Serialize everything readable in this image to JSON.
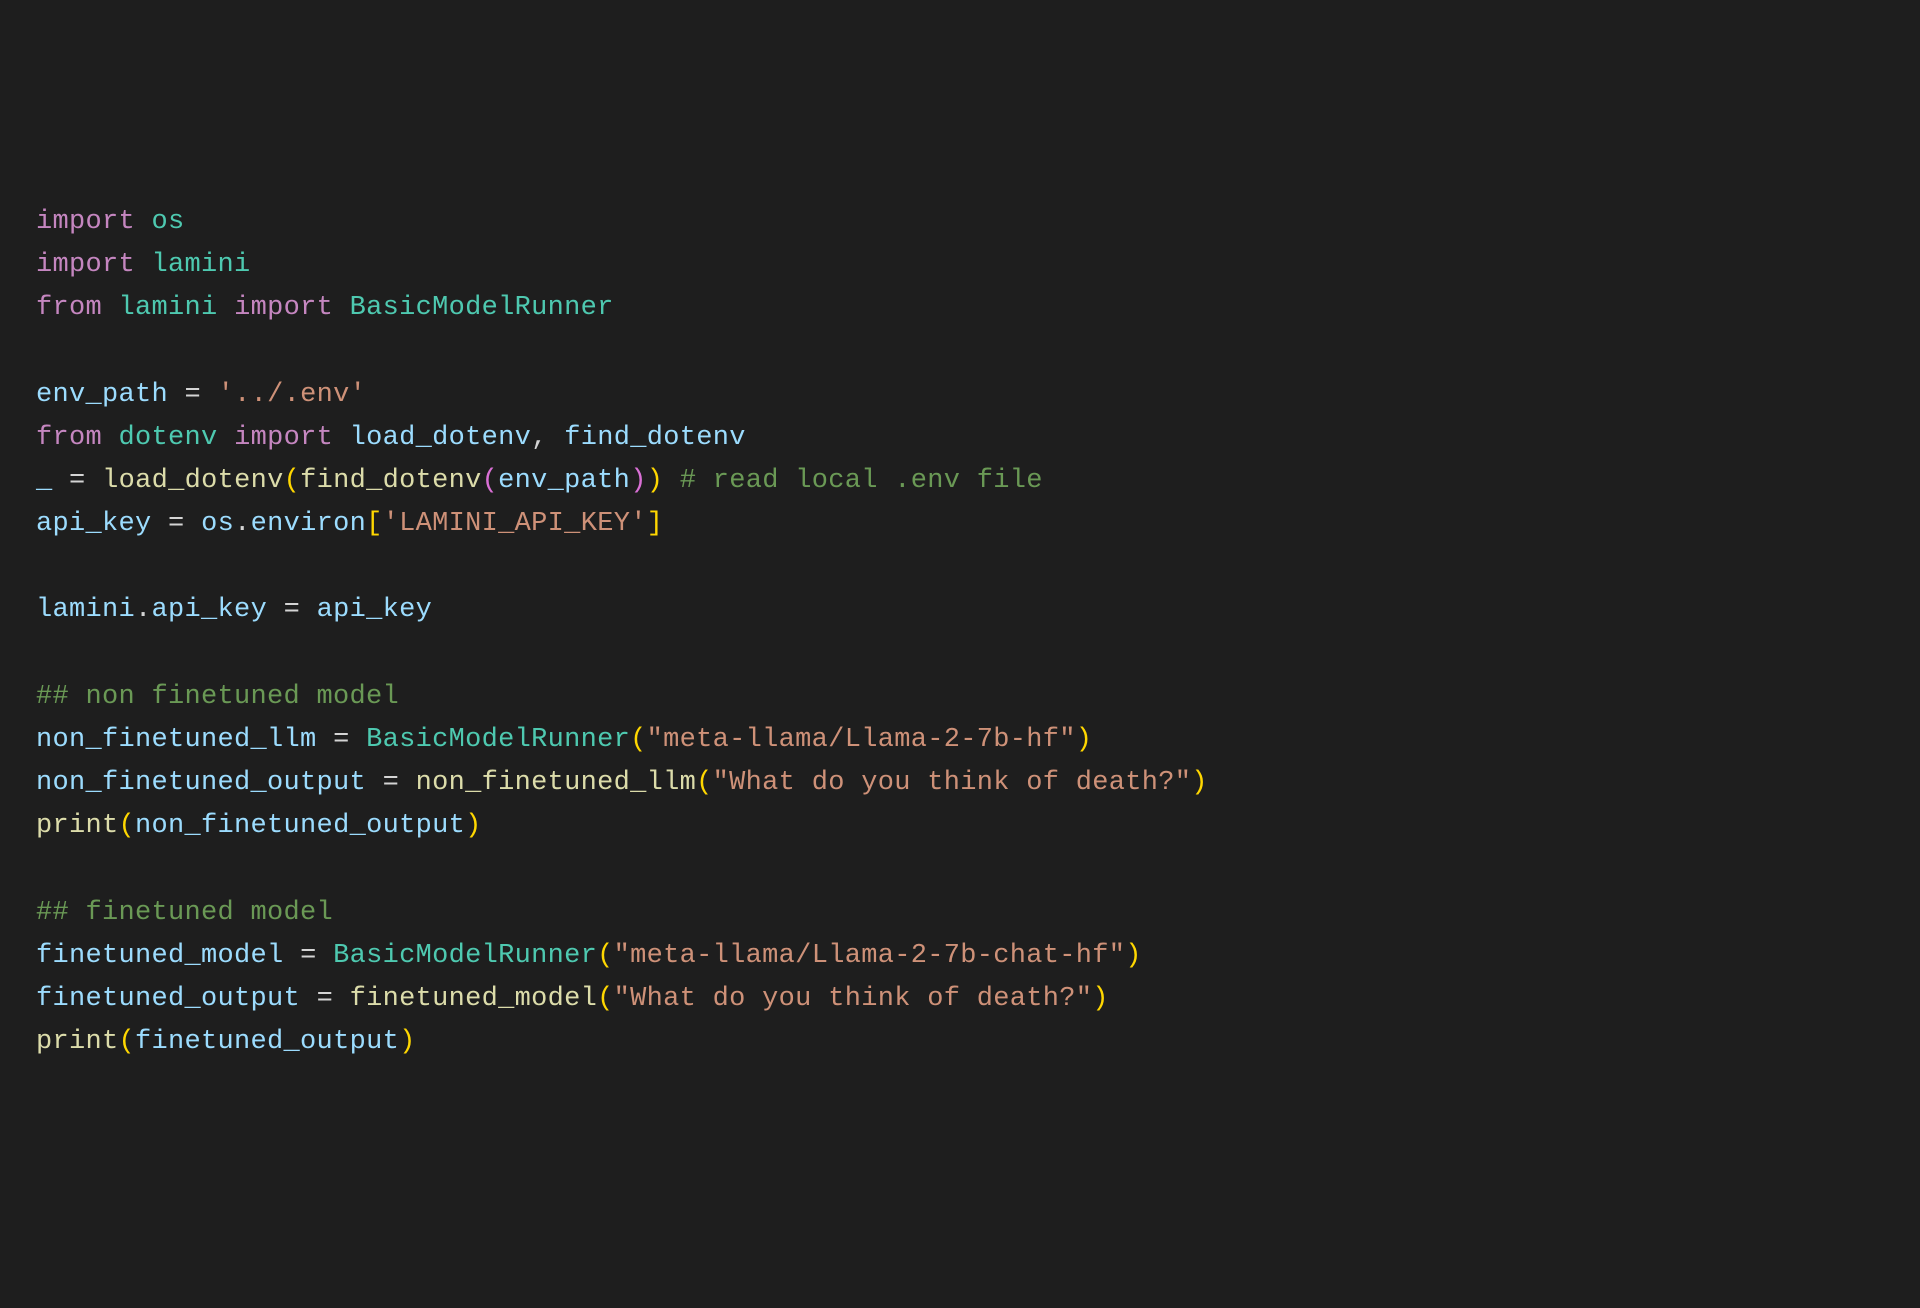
{
  "colors": {
    "keyword": "#c586c0",
    "module": "#4ec9b0",
    "variable": "#9cdcfe",
    "function": "#dcdcaa",
    "string": "#ce9178",
    "comment": "#6a9955",
    "paren": "#ffd700",
    "bracket": "#da70d6",
    "background": "#1e1e1e",
    "default": "#d4d4d4"
  },
  "code": {
    "l1": {
      "kw_import": "import",
      "os": "os"
    },
    "l2": {
      "kw_import": "import",
      "lamini": "lamini"
    },
    "l3": {
      "kw_from": "from",
      "lamini": "lamini",
      "kw_import": "import",
      "bmr": "BasicModelRunner"
    },
    "l5": {
      "env_path": "env_path",
      "eq": "=",
      "str": "'../.env'"
    },
    "l6": {
      "kw_from": "from",
      "dotenv": "dotenv",
      "kw_import": "import",
      "load_dotenv": "load_dotenv",
      "comma": ",",
      "find_dotenv": "find_dotenv"
    },
    "l7": {
      "underscore": "_",
      "eq": "=",
      "load_dotenv": "load_dotenv",
      "find_dotenv": "find_dotenv",
      "env_path": "env_path",
      "cmt": "# read local .env file"
    },
    "l8": {
      "api_key": "api_key",
      "eq": "=",
      "os": "os",
      "dot": ".",
      "environ": "environ",
      "idx": "'LAMINI_API_KEY'"
    },
    "l10": {
      "lamini": "lamini",
      "dot": ".",
      "api_key_attr": "api_key",
      "eq": "=",
      "api_key_var": "api_key"
    },
    "l12": {
      "cmt": "## non finetuned model"
    },
    "l13": {
      "var": "non_finetuned_llm",
      "eq": "=",
      "bmr": "BasicModelRunner",
      "str": "\"meta-llama/Llama-2-7b-hf\""
    },
    "l14": {
      "var": "non_finetuned_output",
      "eq": "=",
      "call": "non_finetuned_llm",
      "str": "\"What do you think of death?\""
    },
    "l15": {
      "print": "print",
      "arg": "non_finetuned_output"
    },
    "l17": {
      "cmt": "## finetuned model"
    },
    "l18": {
      "var": "finetuned_model",
      "eq": "=",
      "bmr": "BasicModelRunner",
      "str": "\"meta-llama/Llama-2-7b-chat-hf\""
    },
    "l19": {
      "var": "finetuned_output",
      "eq": "=",
      "call": "finetuned_model",
      "str": "\"What do you think of death?\""
    },
    "l20": {
      "print": "print",
      "arg": "finetuned_output"
    }
  }
}
